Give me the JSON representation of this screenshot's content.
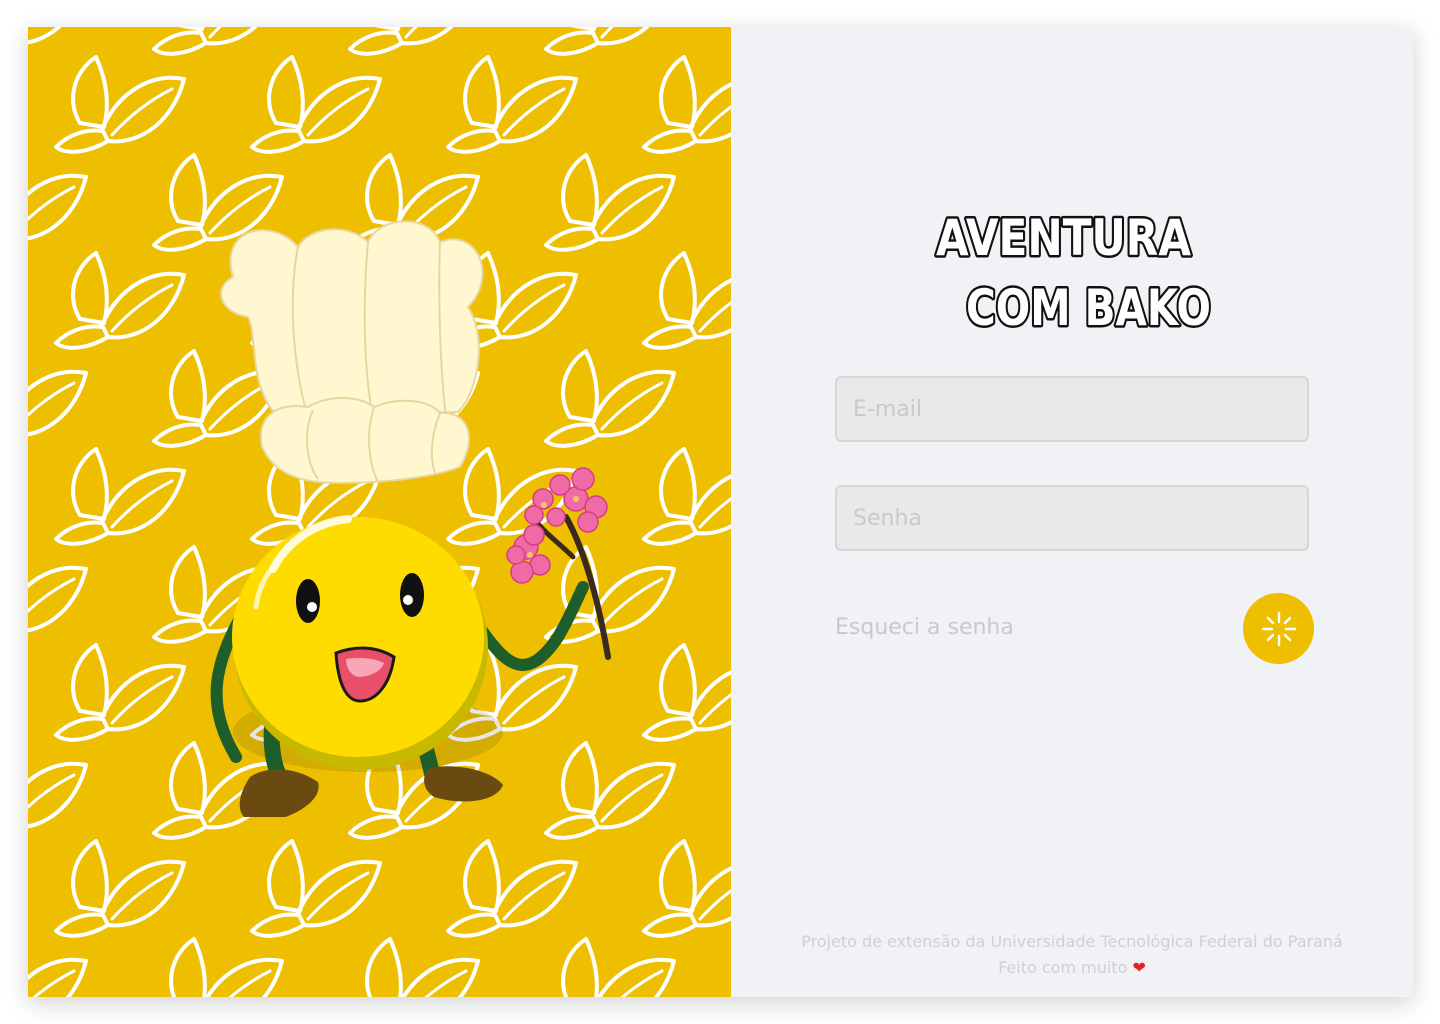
{
  "app": {
    "logo_line1": "AVENTURA",
    "logo_line2": "COM BAKO"
  },
  "login_form": {
    "email_placeholder": "E-mail",
    "password_placeholder": "Senha",
    "forgot_password_label": "Esqueci a senha",
    "submit_icon": "sparkle-icon"
  },
  "footer": {
    "line1": "Projeto de extensão da Universidade Tecnológica Federal do Paraná",
    "line2_prefix": "Feito com muito",
    "line2_suffix_icon": "heart-icon",
    "heart_glyph": "❤"
  },
  "colors": {
    "brand_yellow": "#EDBF00",
    "panel_background": "#F1F2F6",
    "input_background": "#E9E9E9",
    "heart_red": "#E02424"
  }
}
